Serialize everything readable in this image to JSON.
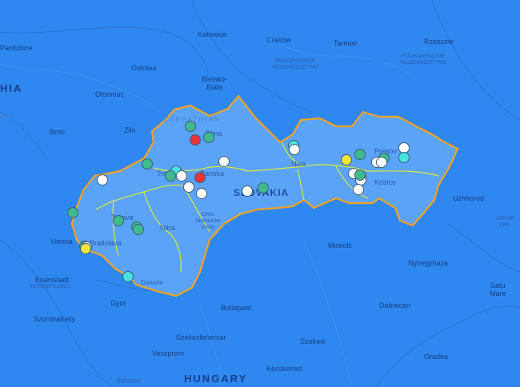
{
  "colors": {
    "background": "#2f88f0",
    "country_fill": "#5ba3f7",
    "country_border": "#f5a21e",
    "region_border": "#d9ea3a",
    "marker_white": "#ffffff",
    "marker_green": "#3fba8c",
    "marker_cyan": "#47e3e0",
    "marker_yellow": "#f3e43a",
    "marker_red": "#e8353b"
  },
  "labels": {
    "katowice": "Katowice",
    "cracow": "Cracow",
    "tarnow": "Tarnow",
    "rzeszow": "Rzeszow",
    "pardubice": "Pardubice",
    "ostrava": "Ostrava",
    "malopolskie": "MALOPOLSKIE",
    "wojewodztwo1": "WOJEWODZTWO",
    "podkarpackie": "PODKARPACKIE",
    "wojewodztwo2": "WOJEWODZTWO",
    "hia": "HIA",
    "olomouc": "Olomouc",
    "bielsko": "Bielsko-",
    "biala": "Biala",
    "ava": "ava",
    "carpathian": "C A R P A T H I A N",
    "brno": "Brno",
    "zlin": "Zlin",
    "zilina": "Zilina",
    "presov": "Presov",
    "trencin": "Trencin",
    "banska": "Banska",
    "slovakia": "SLOVAKIA",
    "kosice": "Kosice",
    "uzhhorod": "Uzhhorod",
    "trnava": "Trnava",
    "nitra": "Nitra",
    "chko1": "Chko",
    "chko2": "Stiavnicke",
    "chko3": "Vrchy",
    "zakar1": "ZAKAR",
    "zakar2": "OBL",
    "vienna": "Vienna",
    "bratislava": "Bratislava",
    "miskolc": "Miskolc",
    "eisenstadt": "Eisenstadt",
    "burgenland": "BURGENLAND",
    "nyiregyhaza": "Nyiregyhaza",
    "danube": "Danube",
    "satu": "Satu",
    "mare": "Mare",
    "gyor": "Gyor",
    "budapest": "Budapest",
    "debrecen": "Debrecen",
    "szombathely": "Szombathely",
    "szekesfehervar": "Szekesfehervar",
    "szolnok": "Szolnok",
    "veszprem": "Veszprem",
    "oradea": "Oradea",
    "hungary": "HUNGARY",
    "kecskemet": "Kecskemet",
    "balaton": "Balaton",
    "nisa": "Nisa"
  },
  "markers": [
    {
      "type": "green",
      "lat": 49.22,
      "lon": 18.74
    },
    {
      "type": "red",
      "lat": 49.12,
      "lon": 18.81
    },
    {
      "type": "green",
      "lat": 49.14,
      "lon": 19.02
    },
    {
      "type": "cyan",
      "lat": 49.08,
      "lon": 20.3
    },
    {
      "type": "white",
      "lat": 49.05,
      "lon": 20.31
    },
    {
      "type": "white",
      "lat": 48.96,
      "lon": 19.25
    },
    {
      "type": "green",
      "lat": 48.94,
      "lon": 18.08
    },
    {
      "type": "cyan",
      "lat": 48.89,
      "lon": 18.52
    },
    {
      "type": "white",
      "lat": 48.85,
      "lon": 18.61
    },
    {
      "type": "red",
      "lat": 48.84,
      "lon": 18.88
    },
    {
      "type": "green",
      "lat": 48.85,
      "lon": 18.44
    },
    {
      "type": "white",
      "lat": 48.82,
      "lon": 17.4
    },
    {
      "type": "white",
      "lat": 48.77,
      "lon": 18.71
    },
    {
      "type": "white",
      "lat": 48.72,
      "lon": 18.91
    },
    {
      "type": "white",
      "lat": 48.74,
      "lon": 19.6
    },
    {
      "type": "green",
      "lat": 48.76,
      "lon": 19.84
    },
    {
      "type": "yellow",
      "lat": 48.97,
      "lon": 21.1
    },
    {
      "type": "green",
      "lat": 49.01,
      "lon": 21.31
    },
    {
      "type": "white",
      "lat": 48.87,
      "lon": 21.21
    },
    {
      "type": "green",
      "lat": 48.84,
      "lon": 21.32
    },
    {
      "type": "white",
      "lat": 48.82,
      "lon": 21.32
    },
    {
      "type": "green",
      "lat": 48.86,
      "lon": 21.31
    },
    {
      "type": "white",
      "lat": 48.75,
      "lon": 21.28
    },
    {
      "type": "white",
      "lat": 48.95,
      "lon": 21.56
    },
    {
      "type": "green",
      "lat": 48.98,
      "lon": 21.67
    },
    {
      "type": "white",
      "lat": 48.95,
      "lon": 21.63
    },
    {
      "type": "white",
      "lat": 49.06,
      "lon": 21.98
    },
    {
      "type": "cyan",
      "lat": 48.99,
      "lon": 21.98
    },
    {
      "type": "green",
      "lat": 48.58,
      "lon": 16.96
    },
    {
      "type": "green",
      "lat": 48.52,
      "lon": 17.65
    },
    {
      "type": "green",
      "lat": 48.47,
      "lon": 17.92
    },
    {
      "type": "green",
      "lat": 48.45,
      "lon": 17.95
    },
    {
      "type": "green",
      "lat": 48.33,
      "lon": 17.14
    },
    {
      "type": "white",
      "lat": 48.32,
      "lon": 17.16
    },
    {
      "type": "yellow",
      "lat": 48.31,
      "lon": 17.15
    },
    {
      "type": "cyan",
      "lat": 48.1,
      "lon": 17.79
    }
  ]
}
